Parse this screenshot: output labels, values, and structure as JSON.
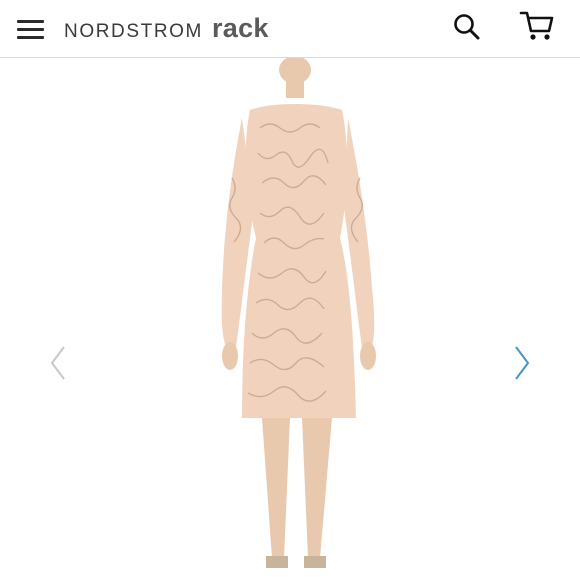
{
  "header": {
    "brand_name": "NORDSTROM",
    "brand_sub": "rack",
    "menu_icon": "hamburger-menu-icon",
    "search_icon": "search-icon",
    "cart_icon": "shopping-cart-icon"
  },
  "gallery": {
    "prev_icon": "chevron-left-icon",
    "next_icon": "chevron-right-icon",
    "prev_color": "#c8c8c8",
    "next_color": "#4a93c4",
    "dress_color": "#f1d3bd",
    "pattern_color": "#c9a58a"
  }
}
